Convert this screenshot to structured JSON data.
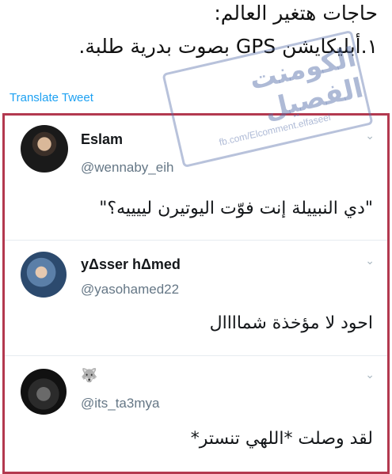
{
  "original_tweet": {
    "line1": "حاجات هتغير العالم:",
    "line2": "١.أبليكايشن GPS بصوت بدرية طلبة.",
    "translate_label": "Translate Tweet"
  },
  "watermark": {
    "title": "الكومنت الفصيل",
    "subtitle": "fb.com/Elcomment.elfaseel"
  },
  "replies": [
    {
      "display_name": "Eslam",
      "handle": "@wennaby_eih",
      "text": "\"دي النبييلة إنت فوّت اليوتيرن لييييه؟\""
    },
    {
      "display_name": "yΔsser hΔmed",
      "handle": "@yasohamed22",
      "text": "احود لا مؤخذة شماااال"
    },
    {
      "display_name": "🐺",
      "handle": "@its_ta3mya",
      "text": "لقد وصلت *اللهي تنستر*"
    }
  ],
  "icons": {
    "menu_chevron": "chevron-down-icon"
  },
  "colors": {
    "frame_border": "#b3394f",
    "translate_link": "#1da1f2",
    "handle_text": "#657786"
  }
}
